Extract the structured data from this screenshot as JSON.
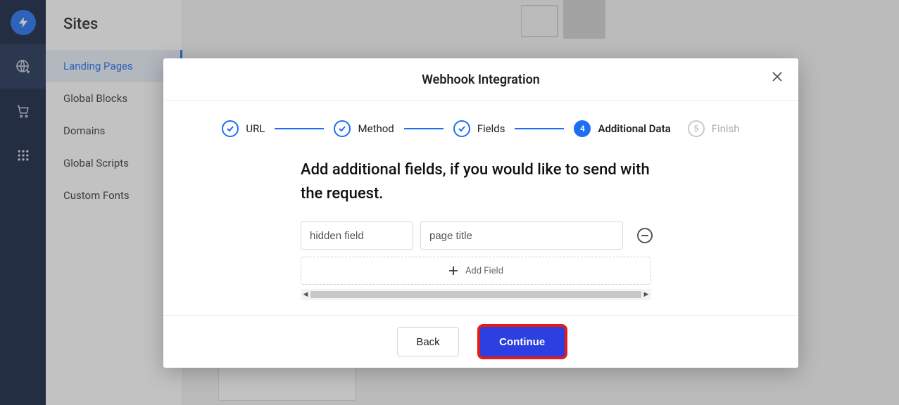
{
  "sidebar": {
    "title": "Sites",
    "items": [
      {
        "label": "Landing Pages",
        "active": true
      },
      {
        "label": "Global Blocks",
        "active": false
      },
      {
        "label": "Domains",
        "active": false
      },
      {
        "label": "Global Scripts",
        "active": false
      },
      {
        "label": "Custom Fonts",
        "active": false
      }
    ]
  },
  "rail": {
    "icons": [
      "bolt-logo",
      "globe-cursor-icon",
      "cart-icon",
      "apps-grid-icon"
    ]
  },
  "modal": {
    "title": "Webhook Integration",
    "steps": [
      {
        "label": "URL",
        "state": "done"
      },
      {
        "label": "Method",
        "state": "done"
      },
      {
        "label": "Fields",
        "state": "done"
      },
      {
        "num": "4",
        "label": "Additional Data",
        "state": "current"
      },
      {
        "num": "5",
        "label": "Finish",
        "state": "upcoming"
      }
    ],
    "heading": "Add additional fields, if you would like to send with the request.",
    "fields": [
      {
        "key": "hidden field",
        "value": "page title"
      }
    ],
    "add_field_label": "Add Field",
    "buttons": {
      "back": "Back",
      "continue": "Continue"
    }
  }
}
